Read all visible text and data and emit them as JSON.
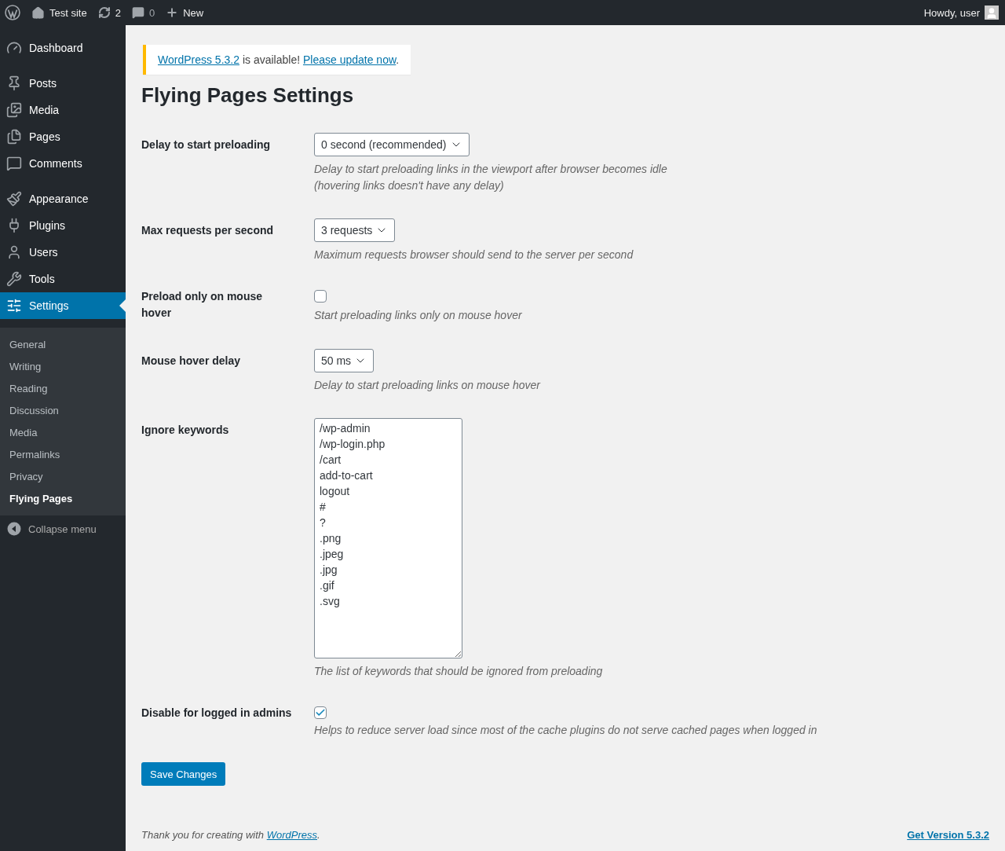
{
  "admin_bar": {
    "site_name": "Test site",
    "updates_count": "2",
    "comments_count": "0",
    "new_label": "New",
    "greeting": "Howdy, user"
  },
  "sidebar": {
    "groups": [
      {
        "items": [
          {
            "label": "Dashboard",
            "selected": false
          }
        ]
      },
      {
        "items": [
          {
            "label": "Posts",
            "selected": false
          },
          {
            "label": "Media",
            "selected": false
          },
          {
            "label": "Pages",
            "selected": false
          },
          {
            "label": "Comments",
            "selected": false
          }
        ]
      },
      {
        "items": [
          {
            "label": "Appearance",
            "selected": false
          },
          {
            "label": "Plugins",
            "selected": false
          },
          {
            "label": "Users",
            "selected": false
          },
          {
            "label": "Tools",
            "selected": false
          },
          {
            "label": "Settings",
            "selected": true
          }
        ]
      }
    ],
    "submenu": [
      {
        "label": "General",
        "selected": false
      },
      {
        "label": "Writing",
        "selected": false
      },
      {
        "label": "Reading",
        "selected": false
      },
      {
        "label": "Discussion",
        "selected": false
      },
      {
        "label": "Media",
        "selected": false
      },
      {
        "label": "Permalinks",
        "selected": false
      },
      {
        "label": "Privacy",
        "selected": false
      },
      {
        "label": "Flying Pages",
        "selected": true
      }
    ],
    "collapse_label": "Collapse menu"
  },
  "notice": {
    "segments": [
      {
        "kind": "link",
        "text": "WordPress 5.3.2"
      },
      {
        "kind": "text",
        "text": " is available! "
      },
      {
        "kind": "link",
        "text": "Please update now"
      },
      {
        "kind": "text",
        "text": "."
      }
    ]
  },
  "title": "Flying Pages Settings",
  "settings": [
    {
      "kind": "select",
      "label": "Delay to start preloading",
      "value": "0 second (recommended)",
      "description": "Delay to start preloading links in the viewport after browser becomes idle (hovering links doesn't have any delay)"
    },
    {
      "kind": "select",
      "label": "Max requests per second",
      "value": "3 requests",
      "description": "Maximum requests browser should send to the server per second"
    },
    {
      "kind": "checkbox",
      "label": "Preload only on mouse hover",
      "checked": false,
      "description": "Start preloading links only on mouse hover"
    },
    {
      "kind": "select",
      "label": "Mouse hover delay",
      "value": "50 ms",
      "description": "Delay to start preloading links on mouse hover"
    },
    {
      "kind": "textarea",
      "label": "Ignore keywords",
      "lines": [
        "/wp-admin",
        "/wp-login.php",
        "/cart",
        "add-to-cart",
        "logout",
        "#",
        "?",
        ".png",
        ".jpeg",
        ".jpg",
        ".gif",
        ".svg"
      ],
      "description": "The list of keywords that should be ignored from preloading"
    },
    {
      "kind": "checkbox",
      "label": "Disable for logged in admins",
      "checked": true,
      "description": "Helps to reduce server load since most of the cache plugins do not serve cached pages when logged in"
    }
  ],
  "save_button": "Save Changes",
  "footer": {
    "text_before": "Thank you for creating with ",
    "link": "WordPress",
    "text_after": ".",
    "version_link": "Get Version 5.3.2"
  }
}
